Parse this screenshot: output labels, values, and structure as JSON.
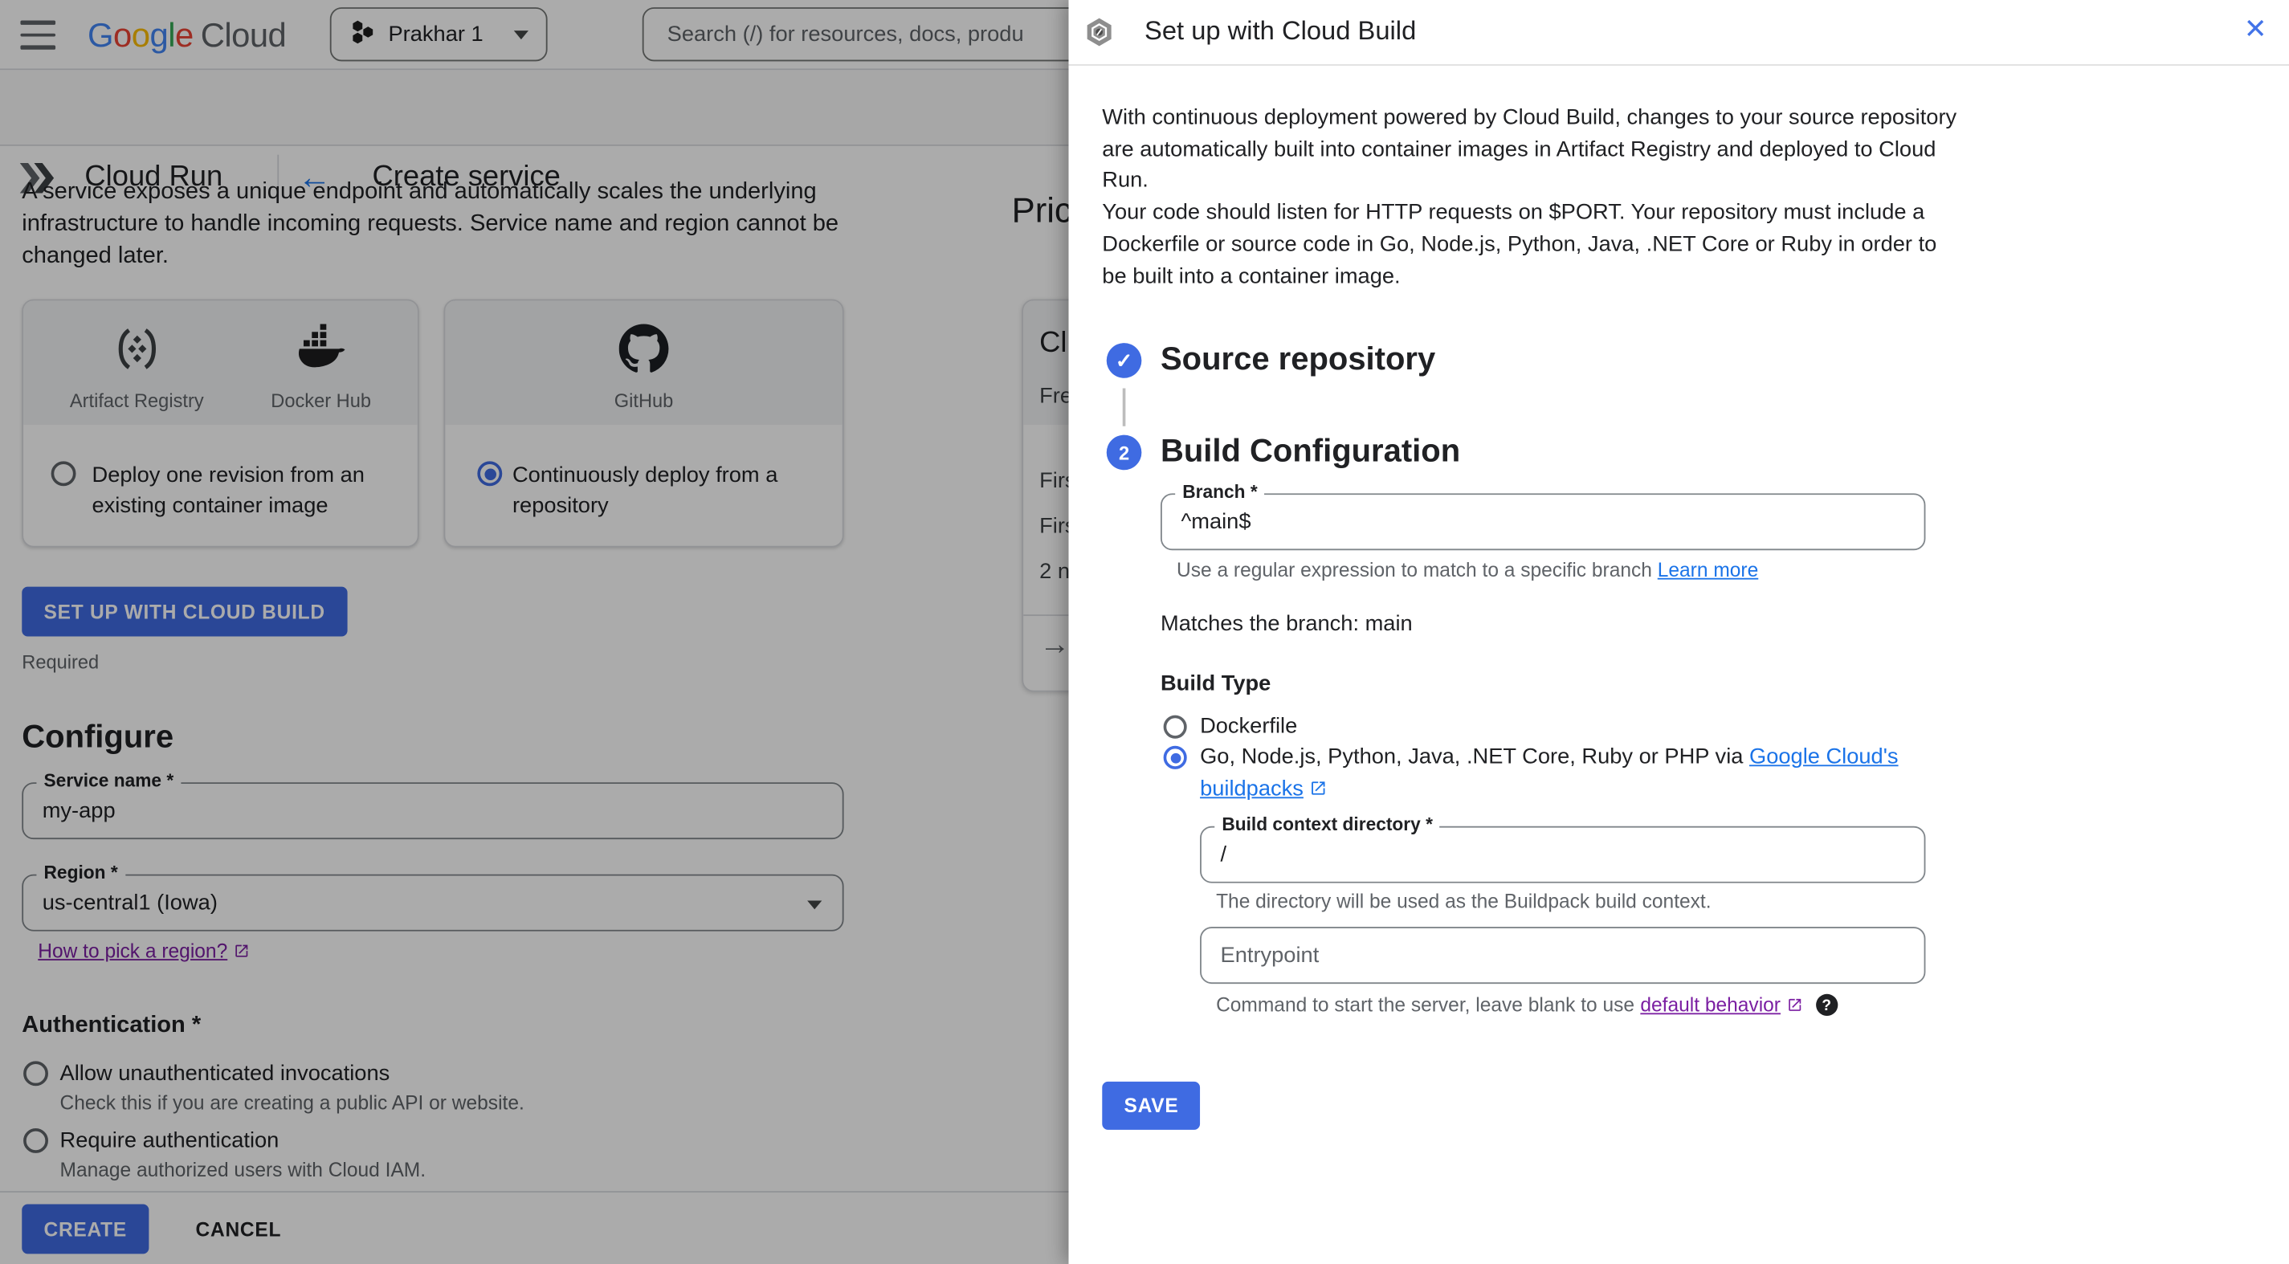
{
  "topbar": {
    "logo_letters": [
      "G",
      "o",
      "o",
      "g",
      "l",
      "e"
    ],
    "logo_cloud": "Cloud",
    "project_name": "Prakhar 1",
    "search_placeholder": "Search (/) for resources, docs, produ"
  },
  "subheader": {
    "product": "Cloud Run",
    "title": "Create service"
  },
  "main": {
    "intro": "A service exposes a unique endpoint and automatically scales the underlying infrastructure to handle incoming requests. Service name and region cannot be changed later.",
    "cards": {
      "card1": {
        "icon1_label": "Artifact Registry",
        "icon2_label": "Docker Hub",
        "option": "Deploy one revision from an existing container image"
      },
      "card2": {
        "icon_label": "GitHub",
        "option": "Continuously deploy from a repository"
      }
    },
    "setup_button": "SET UP WITH CLOUD BUILD",
    "required_note": "Required",
    "configure": {
      "heading": "Configure",
      "service_name": {
        "label": "Service name *",
        "value": "my-app"
      },
      "region": {
        "label": "Region *",
        "value": "us-central1 (Iowa)",
        "help_link": "How to pick a region?"
      }
    },
    "authentication": {
      "heading": "Authentication *",
      "options": [
        {
          "label": "Allow unauthenticated invocations",
          "helper": "Check this if you are creating a public API or website."
        },
        {
          "label": "Require authentication",
          "helper": "Manage authorized users with Cloud IAM."
        }
      ]
    },
    "footer": {
      "create": "CREATE",
      "cancel": "CANCEL"
    }
  },
  "pricing": {
    "heading": "Pric",
    "card_title": "Cl",
    "card_subtitle": "Fre",
    "rows": [
      "Firs",
      "Firs",
      "2 n"
    ]
  },
  "panel": {
    "title": "Set up with Cloud Build",
    "intro_line1": "With continuous deployment powered by Cloud Build, changes to your source repository are automatically built into container images in Artifact Registry and deployed to Cloud Run.",
    "intro_line2": "Your code should listen for HTTP requests on $PORT. Your repository must include a Dockerfile or source code in Go, Node.js, Python, Java, .NET Core or Ruby in order to be built into a container image.",
    "step1_title": "Source repository",
    "step2_number": "2",
    "step2_title": "Build Configuration",
    "branch": {
      "label": "Branch *",
      "value": "^main$",
      "helper": "Use a regular expression to match to a specific branch ",
      "helper_link": "Learn more"
    },
    "match_note": "Matches the branch: main",
    "build_type": {
      "label": "Build Type",
      "option1": "Dockerfile",
      "option2_prefix": "Go, Node.js, Python, Java, .NET Core, Ruby or PHP via ",
      "option2_link": "Google Cloud's buildpacks"
    },
    "context_dir": {
      "label": "Build context directory *",
      "value": "/",
      "helper": "The directory will be used as the Buildpack build context."
    },
    "entrypoint": {
      "placeholder": "Entrypoint",
      "helper_prefix": "Command to start the server, leave blank to use ",
      "helper_link": "default behavior"
    },
    "save_button": "SAVE"
  },
  "icons": {
    "back_arrow": "←",
    "close": "✕",
    "check": "✓",
    "arrow_right": "→",
    "help": "?"
  },
  "colors": {
    "primary_blue": "#3f6be2",
    "link_blue": "#1a73e8",
    "visited_purple": "#7b1fa2",
    "text_primary": "#202124",
    "text_secondary": "#5f6368",
    "scrim": "rgba(0,0,0,0.33)"
  }
}
